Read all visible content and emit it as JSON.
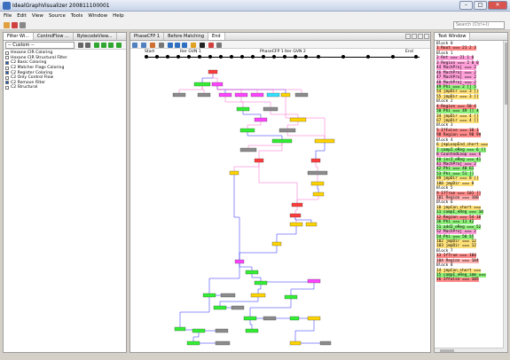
{
  "window": {
    "title": "IdealGraphVisualizer 200811100001"
  },
  "menu": [
    "File",
    "Edit",
    "View",
    "Source",
    "Tools",
    "Window",
    "Help"
  ],
  "search": {
    "placeholder": "Search (Ctrl+I)"
  },
  "left_panel": {
    "tabs": [
      "Filter Wi...",
      "ControlFlow ...",
      "BytecodeView..."
    ],
    "filter_select": "-- Custom --",
    "filters": [
      {
        "label": "Hexane CIR Coloring",
        "checked": false
      },
      {
        "label": "Hexane CIR Structural Filter",
        "checked": false
      },
      {
        "label": "C2 Basic Coloring",
        "checked": true
      },
      {
        "label": "C2 Matcher Flags Coloring",
        "checked": false
      },
      {
        "label": "C2 Register Coloring",
        "checked": true
      },
      {
        "label": "C2 Only Control Flow",
        "checked": false
      },
      {
        "label": "C2 Remove Filter",
        "checked": true
      },
      {
        "label": "C2 Structural",
        "checked": false
      }
    ]
  },
  "center_panel": {
    "tabs": [
      "PhaseCFP 1",
      "Before Matching",
      "End"
    ],
    "timeline": {
      "labels": [
        "Start",
        "Iter GVN 1",
        "PhaseCFP 1",
        "Iter GVN 2",
        "End"
      ]
    }
  },
  "right_panel": {
    "tab": "Text Window",
    "lines": [
      {
        "text": "Block 0",
        "kind": "block"
      },
      {
        "text": "1 Root === 21  2  3",
        "hl": "red"
      },
      {
        "text": "Block 1",
        "kind": "block"
      },
      {
        "text": "2 Ret === 21  1  0",
        "hl": "pink"
      },
      {
        "text": "3 Region === 2  0  0",
        "hl": "pink"
      },
      {
        "text": "44 MachProj === 2",
        "hl": "pink"
      },
      {
        "text": "46 MachProj === 2",
        "hl": "pink"
      },
      {
        "text": "47 MachProj === 2",
        "hl": "pink"
      },
      {
        "text": "48 MachProj === 2",
        "hl": "pink"
      },
      {
        "text": "49 Phi === 2  [] 5",
        "hl": "green"
      },
      {
        "text": "54 jmpDir === 3  []",
        "hl": "yellow"
      },
      {
        "text": "55 jmpDir === 3  []",
        "hl": "yellow"
      },
      {
        "text": "Block 2",
        "kind": "block"
      },
      {
        "text": "4 Region === 50  4",
        "hl": "red"
      },
      {
        "text": "50 Phi === 49  [] 4",
        "hl": "green"
      },
      {
        "text": "34 jmpDir === 4  []",
        "hl": "yellow"
      },
      {
        "text": "67 jmpDir === 4  []",
        "hl": "yellow"
      },
      {
        "text": "Block 3",
        "kind": "block"
      },
      {
        "text": "5 IfFalse === 38  1",
        "hl": "red"
      },
      {
        "text": "98 Region === 98  99",
        "hl": "red"
      },
      {
        "text": "Block 4",
        "kind": "block"
      },
      {
        "text": "6 jmpLoopEnd_short ===",
        "hl": "yellow"
      },
      {
        "text": "7 compI_eReg === 6  []",
        "hl": "green"
      },
      {
        "text": "8 CountedLoop === 6",
        "hl": "pink"
      },
      {
        "text": "40 incI_eReg === 41",
        "hl": "green"
      },
      {
        "text": "41 MachProj === 2",
        "hl": "pink"
      },
      {
        "text": "42 Phi === 40  61",
        "hl": "green"
      },
      {
        "text": "53 Phi === 51  []",
        "hl": "green"
      },
      {
        "text": "89 jmpDir === 8  []",
        "hl": "yellow"
      },
      {
        "text": "100 jmpDir === 8",
        "hl": "yellow"
      },
      {
        "text": "Block 5",
        "kind": "block"
      },
      {
        "text": "9 IfTrue === 101  []",
        "hl": "red"
      },
      {
        "text": "101 Region === 100",
        "hl": "lightred"
      },
      {
        "text": "Block 6",
        "kind": "block"
      },
      {
        "text": "10 jmpCon_short ===",
        "hl": "yellow"
      },
      {
        "text": "11 compI_eReg === 10",
        "hl": "green"
      },
      {
        "text": "12 Region === 54  10",
        "hl": "red"
      },
      {
        "text": "36 Phi === 11  42",
        "hl": "green"
      },
      {
        "text": "51 addI_eReg === 52",
        "hl": "green"
      },
      {
        "text": "52 MachProj === 2",
        "hl": "pink"
      },
      {
        "text": "54 Phi === 50  55",
        "hl": "green"
      },
      {
        "text": "102 jmpDir === 12",
        "hl": "yellow"
      },
      {
        "text": "103 jmpDir === 12",
        "hl": "yellow"
      },
      {
        "text": "Block 7",
        "kind": "block"
      },
      {
        "text": "13 IfTrue === 104",
        "hl": "red"
      },
      {
        "text": "104 Region === 104",
        "hl": "lightred"
      },
      {
        "text": "Block 8",
        "kind": "block"
      },
      {
        "text": "14 jmpCon_short ===",
        "hl": "yellow"
      },
      {
        "text": "15 compI_eReg_imm ===",
        "hl": "green"
      },
      {
        "text": "16 IfFalse === 105",
        "hl": "red"
      }
    ]
  },
  "graph": {
    "colors": {
      "red": "#ff3b3b",
      "magenta": "#ff44ff",
      "green": "#33ee33",
      "gray": "#8c8c8c",
      "yellow": "#ffd400",
      "cyan": "#33e0ff",
      "edge_blue": "#2222ff",
      "edge_pink": "#ff66cc"
    }
  }
}
